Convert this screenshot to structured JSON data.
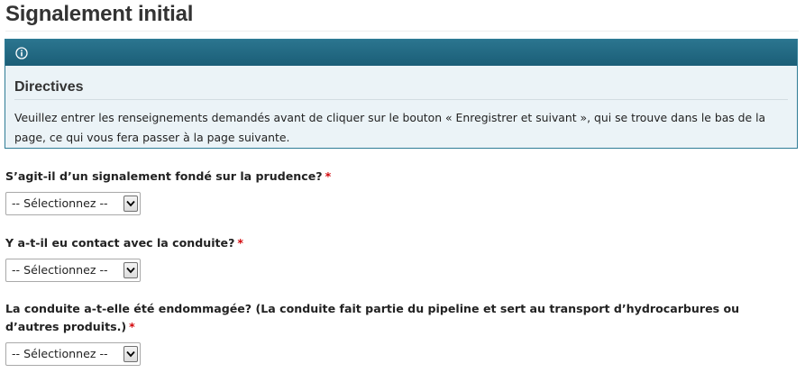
{
  "page": {
    "title": "Signalement initial"
  },
  "directives": {
    "icon": "info-icon",
    "title": "Directives",
    "text": "Veuillez entrer les renseignements demandés avant de cliquer sur le bouton « Enregistrer et suivant », qui se trouve dans le bas de la page, ce qui vous fera passer à la page suivante."
  },
  "questions": [
    {
      "label": "S’agit-il d’un signalement fondé sur la prudence?",
      "required_mark": "*",
      "select_value": "-- Sélectionnez --"
    },
    {
      "label": "Y a-t-il eu contact avec la conduite?",
      "required_mark": "*",
      "select_value": "-- Sélectionnez --"
    },
    {
      "label": "La conduite a-t-elle été endommagée? (La conduite fait partie du pipeline et sert au transport d’hydrocarbures ou d’autres produits.)",
      "required_mark": "*",
      "select_value": "-- Sélectionnez --"
    }
  ],
  "colors": {
    "header_bar": "#1b5e77",
    "panel_background": "#ebf3f7",
    "required": "#d3080c"
  }
}
